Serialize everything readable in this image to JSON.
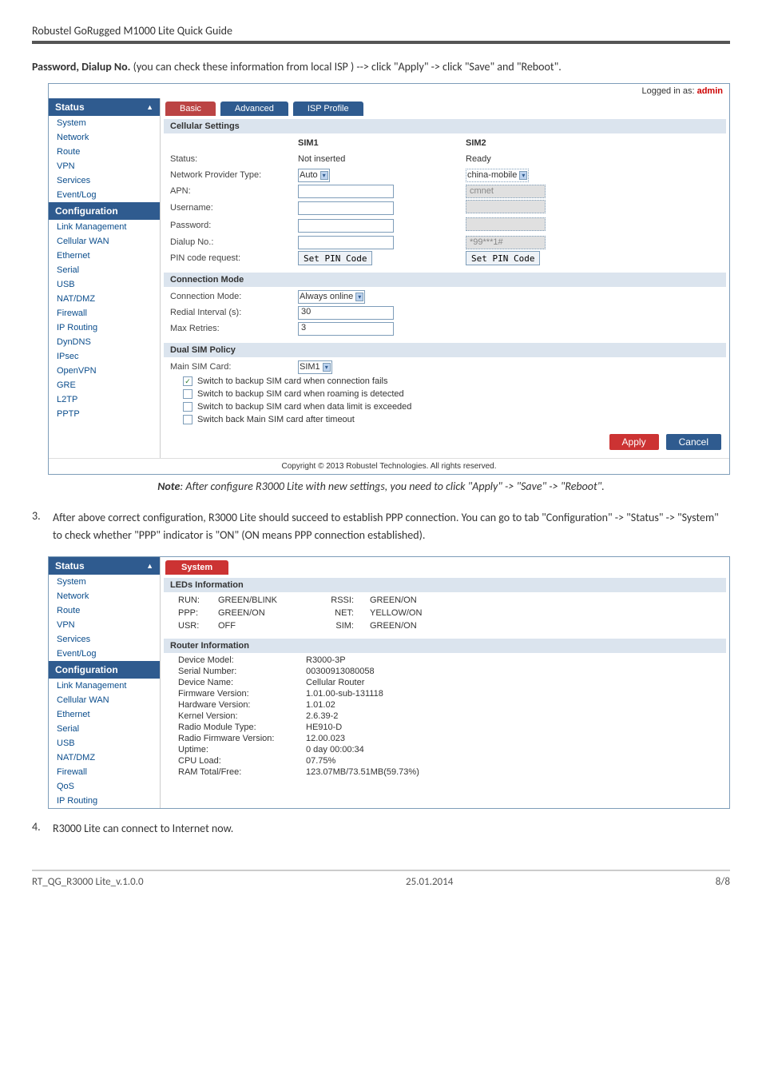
{
  "page": {
    "header": "Robustel GoRugged M1000 Lite Quick Guide",
    "intro_bold": "Password, Dialup No.",
    "intro_rest": " (you can check these information from local ISP ) --> click \"Apply\" -> click \"Save\" and \"Reboot\".",
    "note_label": "Note",
    "note_text": ": After configure R3000 Lite with new settings, you need to click \"Apply\" -> \"Save\" -> \"Reboot\".",
    "step3_num": "3.",
    "step3_text": "After above correct configuration, R3000 Lite should succeed to establish PPP connection. You can go to tab \"Configuration\" -> \"Status\" -> \"System\" to check whether \"PPP\" indicator is \"ON\" (ON means PPP connection established).",
    "step4_num": "4.",
    "step4_text": "R3000 Lite can connect to Internet now.",
    "footer_left": "RT_QG_R3000 Lite_v.1.0.0",
    "footer_center": "25.01.2014",
    "footer_right": "8/8"
  },
  "shot1": {
    "logged_in_prefix": "Logged in as: ",
    "logged_in_user": "admin",
    "sidebar": {
      "status_header": "Status",
      "status_items": [
        "System",
        "Network",
        "Route",
        "VPN",
        "Services",
        "Event/Log"
      ],
      "config_header": "Configuration",
      "config_items": [
        "Link Management",
        "Cellular WAN",
        "Ethernet",
        "Serial",
        "USB",
        "NAT/DMZ",
        "Firewall",
        "IP Routing",
        "DynDNS",
        "IPsec",
        "OpenVPN",
        "GRE",
        "L2TP",
        "PPTP"
      ]
    },
    "tabs": {
      "basic": "Basic",
      "advanced": "Advanced",
      "isp": "ISP Profile"
    },
    "cellular": {
      "title": "Cellular Settings",
      "sim1": "SIM1",
      "sim2": "SIM2",
      "status_lbl": "Status:",
      "status1": "Not inserted",
      "status2": "Ready",
      "provider_lbl": "Network Provider Type:",
      "provider1": "Auto",
      "provider2": "china-mobile",
      "apn_lbl": "APN:",
      "apn2": "cmnet",
      "user_lbl": "Username:",
      "pass_lbl": "Password:",
      "dial_lbl": "Dialup No.:",
      "dial2": "*99***1#",
      "pin_lbl": "PIN code request:",
      "pin_btn": "Set PIN Code"
    },
    "connmode": {
      "title": "Connection Mode",
      "mode_lbl": "Connection Mode:",
      "mode_val": "Always online",
      "redial_lbl": "Redial Interval (s):",
      "redial_val": "30",
      "retries_lbl": "Max Retries:",
      "retries_val": "3"
    },
    "dualsim": {
      "title": "Dual SIM Policy",
      "main_lbl": "Main SIM Card:",
      "main_val": "SIM1",
      "cb1": "Switch to backup SIM card when connection fails",
      "cb2": "Switch to backup SIM card when roaming is detected",
      "cb3": "Switch to backup SIM card when data limit is exceeded",
      "cb4": "Switch back Main SIM card after timeout"
    },
    "buttons": {
      "apply": "Apply",
      "cancel": "Cancel"
    },
    "copyright": "Copyright © 2013 Robustel Technologies. All rights reserved."
  },
  "shot2": {
    "sidebar": {
      "status_header": "Status",
      "status_items": [
        "System",
        "Network",
        "Route",
        "VPN",
        "Services",
        "Event/Log"
      ],
      "config_header": "Configuration",
      "config_items": [
        "Link Management",
        "Cellular WAN",
        "Ethernet",
        "Serial",
        "USB",
        "NAT/DMZ",
        "Firewall",
        "QoS",
        "IP Routing"
      ]
    },
    "tab": "System",
    "leds": {
      "title": "LEDs Information",
      "rows": [
        {
          "a": "RUN:",
          "b": "GREEN/BLINK",
          "c": "RSSI:",
          "d": "GREEN/ON"
        },
        {
          "a": "PPP:",
          "b": "GREEN/ON",
          "c": "NET:",
          "d": "YELLOW/ON"
        },
        {
          "a": "USR:",
          "b": "OFF",
          "c": "SIM:",
          "d": "GREEN/ON"
        }
      ]
    },
    "router": {
      "title": "Router Information",
      "rows": [
        {
          "l": "Device Model:",
          "v": "R3000-3P"
        },
        {
          "l": "Serial Number:",
          "v": "00300913080058"
        },
        {
          "l": "Device Name:",
          "v": "Cellular Router"
        },
        {
          "l": "Firmware Version:",
          "v": "1.01.00-sub-131118"
        },
        {
          "l": "Hardware Version:",
          "v": "1.01.02"
        },
        {
          "l": "Kernel Version:",
          "v": "2.6.39-2"
        },
        {
          "l": "Radio Module Type:",
          "v": "HE910-D"
        },
        {
          "l": "Radio Firmware Version:",
          "v": "12.00.023"
        },
        {
          "l": "Uptime:",
          "v": "0 day 00:00:34"
        },
        {
          "l": "CPU Load:",
          "v": "07.75%"
        },
        {
          "l": "RAM Total/Free:",
          "v": "123.07MB/73.51MB(59.73%)"
        }
      ]
    }
  }
}
